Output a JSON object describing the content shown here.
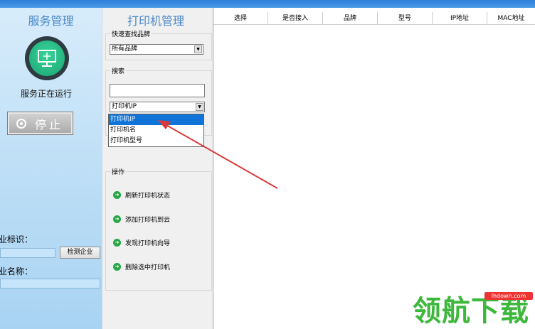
{
  "left_panel": {
    "title": "服务管理",
    "status_text": "服务正在运行",
    "stop_button": "停止",
    "company_id_label": "业标识：",
    "check_company_button": "检测企业",
    "company_name_label": "业名称："
  },
  "mid_panel": {
    "title": "打印机管理",
    "brand_group": {
      "label": "快速查找品牌",
      "selected": "所有品牌"
    },
    "search_group": {
      "label": "搜索",
      "input_value": "",
      "type_selected": "打印机IP",
      "options": [
        "打印机IP",
        "打印机名",
        "打印机型号"
      ]
    },
    "operations": {
      "label": "操作",
      "items": [
        "刷新打印机状态",
        "添加打印机到云",
        "发现打印机向导",
        "删除选中打印机"
      ]
    }
  },
  "table": {
    "columns": [
      "选择",
      "是否接入",
      "品牌",
      "型号",
      "IP地址",
      "MAC地址"
    ]
  },
  "watermark": {
    "text": "领航下载",
    "url": "lhdown.com"
  },
  "colors": {
    "accent": "#4a87c6",
    "selection": "#0f73d8",
    "arrow": "#d83a3a"
  }
}
